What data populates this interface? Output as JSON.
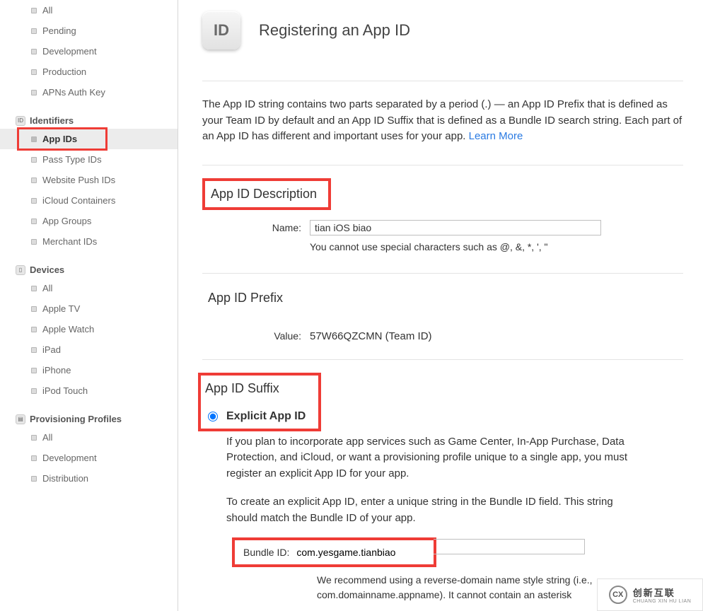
{
  "sidebar": {
    "certificates": {
      "items": [
        "All",
        "Pending",
        "Development",
        "Production",
        "APNs Auth Key"
      ]
    },
    "identifiers": {
      "title": "Identifiers",
      "icon_text": "ID",
      "items": [
        "App IDs",
        "Pass Type IDs",
        "Website Push IDs",
        "iCloud Containers",
        "App Groups",
        "Merchant IDs"
      ],
      "selected_index": 0
    },
    "devices": {
      "title": "Devices",
      "items": [
        "All",
        "Apple TV",
        "Apple Watch",
        "iPad",
        "iPhone",
        "iPod Touch"
      ]
    },
    "profiles": {
      "title": "Provisioning Profiles",
      "items": [
        "All",
        "Development",
        "Distribution"
      ]
    }
  },
  "main": {
    "icon_text": "ID",
    "page_title": "Registering an App ID",
    "intro_text": "The App ID string contains two parts separated by a period (.) — an App ID Prefix that is defined as your Team ID by default and an App ID Suffix that is defined as a Bundle ID search string. Each part of an App ID has different and important uses for your app. ",
    "learn_more": "Learn More",
    "desc": {
      "heading": "App ID Description",
      "name_label": "Name:",
      "name_value": "tian iOS biao",
      "name_hint": "You cannot use special characters such as @, &, *, ', \""
    },
    "prefix": {
      "heading": "App ID Prefix",
      "value_label": "Value:",
      "value": "57W66QZCMN (Team ID)"
    },
    "suffix": {
      "heading": "App ID Suffix",
      "explicit_label": "Explicit App ID",
      "explicit_selected": true,
      "p1": "If you plan to incorporate app services such as Game Center, In-App Purchase, Data Protection, and iCloud, or want a provisioning profile unique to a single app, you must register an explicit App ID for your app.",
      "p2": "To create an explicit App ID, enter a unique string in the Bundle ID field. This string should match the Bundle ID of your app.",
      "bundle_label": "Bundle ID:",
      "bundle_value": "com.yesgame.tianbiao",
      "bundle_hint": "We recommend using a reverse-domain name style string (i.e., com.domainname.appname). It cannot contain an asterisk"
    }
  },
  "watermark": {
    "logo_text": "CX",
    "cn": "创新互联",
    "en": "CHUANG XIN HU LIAN"
  }
}
